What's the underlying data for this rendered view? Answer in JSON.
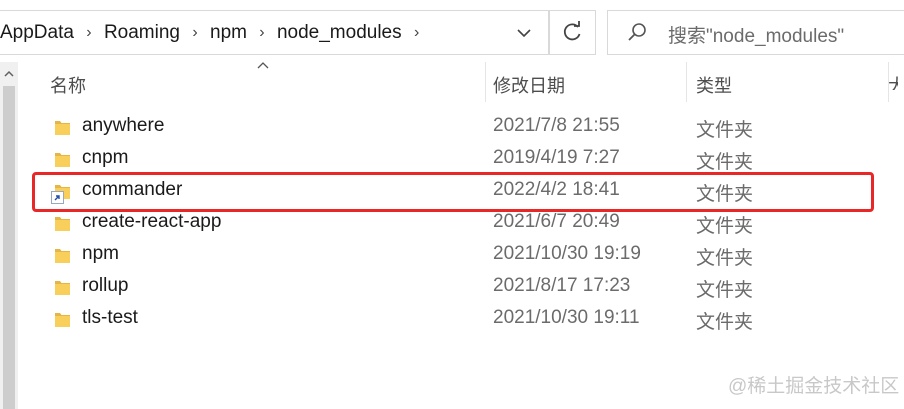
{
  "address_bar": {
    "breadcrumbs": [
      "AppData",
      "Roaming",
      "npm",
      "node_modules"
    ],
    "separator_icon": "chevron-right-icon",
    "dropdown_icon": "chevron-down-icon"
  },
  "refresh_icon": "refresh-icon",
  "search": {
    "placeholder": "搜索\"node_modules\"",
    "icon": "search-icon"
  },
  "columns": {
    "name": "名称",
    "date_modified": "修改日期",
    "type": "类型"
  },
  "files": [
    {
      "name": "anywhere",
      "date": "2021/7/8 21:55",
      "type": "文件夹",
      "shortcut": false
    },
    {
      "name": "cnpm",
      "date": "2019/4/19 7:27",
      "type": "文件夹",
      "shortcut": false
    },
    {
      "name": "commander",
      "date": "2022/4/2 18:41",
      "type": "文件夹",
      "shortcut": true,
      "highlighted": true
    },
    {
      "name": "create-react-app",
      "date": "2021/6/7 20:49",
      "type": "文件夹",
      "shortcut": false
    },
    {
      "name": "npm",
      "date": "2021/10/30 19:19",
      "type": "文件夹",
      "shortcut": false
    },
    {
      "name": "rollup",
      "date": "2021/8/17 17:23",
      "type": "文件夹",
      "shortcut": false
    },
    {
      "name": "tls-test",
      "date": "2021/10/30 19:11",
      "type": "文件夹",
      "shortcut": false
    }
  ],
  "colors": {
    "highlight_border": "#ea2727",
    "folder_yellow": "#f8cf5a"
  },
  "watermark": "@稀土掘金技术社区"
}
